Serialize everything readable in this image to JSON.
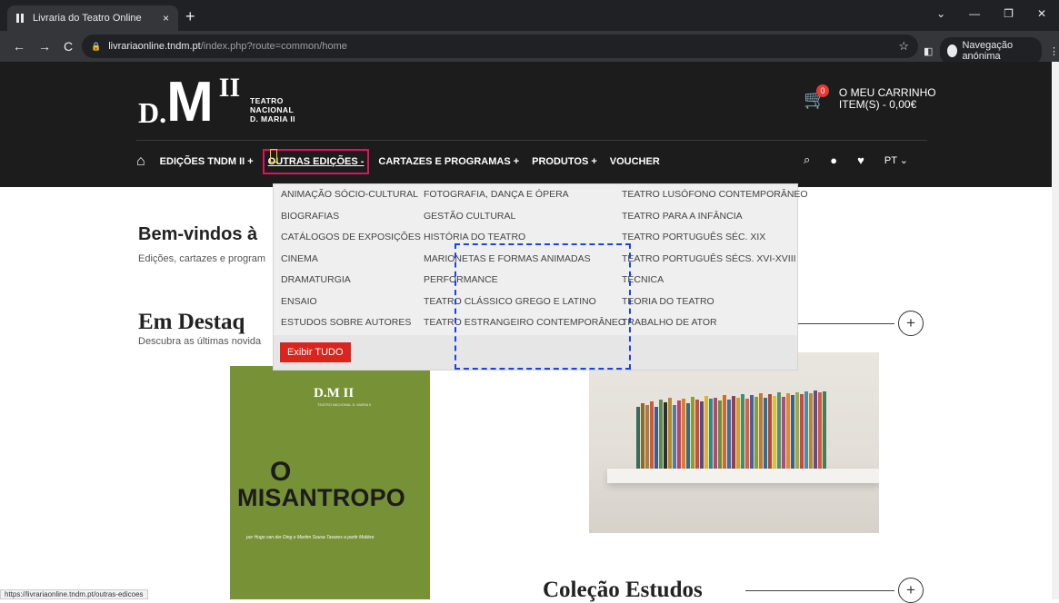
{
  "browser": {
    "tab_title": "Livraria do Teatro Online",
    "tab_close": "×",
    "new_tab": "+",
    "url_host": "livrariaonline.tndm.pt",
    "url_path": "/index.php?route=common/home",
    "incognito_label": "Navegação anónima",
    "status_url": "https://livrariaonline.tndm.pt/outras-edicoes"
  },
  "header": {
    "logo_d": "D.",
    "logo_m": "M",
    "logo_ii": "II",
    "logo_line1": "TEATRO",
    "logo_line2": "NACIONAL",
    "logo_line3": "D. MARIA II",
    "cart_count": "0",
    "cart_line1": "O MEU CARRINHO",
    "cart_line2": "ITEM(S) - 0,00€"
  },
  "nav": {
    "items": [
      {
        "label": "EDIÇÕES TNDM II +"
      },
      {
        "label": "OUTRAS EDIÇÕES -"
      },
      {
        "label": "CARTAZES E PROGRAMAS +"
      },
      {
        "label": "PRODUTOS +"
      },
      {
        "label": "VOUCHER"
      }
    ],
    "lang": "PT"
  },
  "dropdown": {
    "col1": [
      "ANIMAÇÃO SÓCIO-CULTURAL",
      "BIOGRAFIAS",
      "CATÁLOGOS DE EXPOSIÇÕES",
      "CINEMA",
      "DRAMATURGIA",
      "ENSAIO",
      "ESTUDOS SOBRE AUTORES"
    ],
    "col2": [
      "FOTOGRAFIA, DANÇA E ÓPERA",
      "GESTÃO CULTURAL",
      "HISTÓRIA DO TEATRO",
      "MARIONETAS E FORMAS ANIMADAS",
      "PERFORMANCE",
      "TEATRO CLÁSSICO GREGO E LATINO",
      "TEATRO ESTRANGEIRO CONTEMPORÂNEO"
    ],
    "col3": [
      "TEATRO LUSÓFONO CONTEMPORÂNEO",
      "TEATRO PARA A INFÂNCIA",
      "TEATRO PORTUGUÊS SÉC. XIX",
      "TEATRO PORTUGUÊS SÉCS. XVI-XVIII",
      "TÉCNICA",
      "TEORIA DO TEATRO",
      "TRABALHO DE ATOR"
    ],
    "button": "Exibir TUDO"
  },
  "content": {
    "welcome": "Bem-vindos à",
    "welcome_sub": "Edições, cartazes e program",
    "destaque": "Em Destaq",
    "destaque_sub": "Descubra as últimas novida",
    "colecao": "Coleção Estudos",
    "plus": "+"
  },
  "book": {
    "logo": "D.M II",
    "small": "TEATRO NACIONAL D. MARIA II",
    "o": "O",
    "title": "MISANTROPO",
    "credit": "por Hugo van der Ding e Martim Sousa Tavares a partir Molière"
  }
}
